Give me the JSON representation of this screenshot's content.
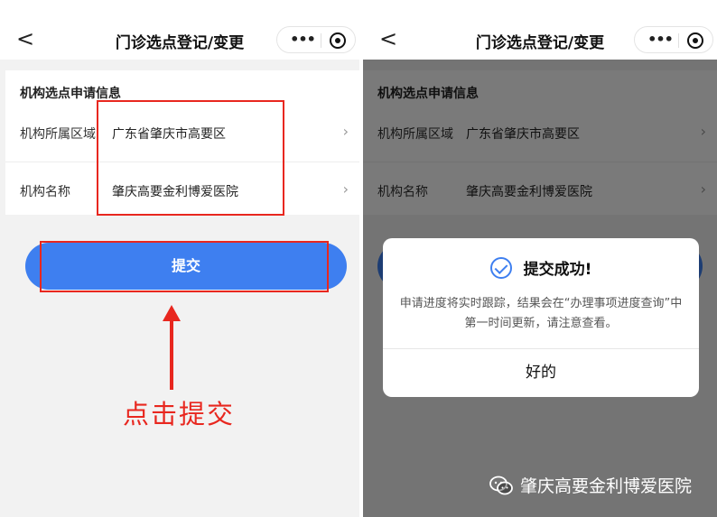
{
  "nav": {
    "back_glyph": "<",
    "title": "门诊选点登记/变更",
    "more_glyph": "•••",
    "status_dots": "••••"
  },
  "form": {
    "section_title": "机构选点申请信息",
    "fields": [
      {
        "label": "机构所属区域",
        "value": "广东省肇庆市高要区",
        "arrow": "›"
      },
      {
        "label": "机构名称",
        "value": "肇庆高要金利博爱医院",
        "arrow": "›"
      }
    ],
    "submit_label": "提交"
  },
  "annotation": {
    "hint": "点击提交",
    "color": "#e8271f"
  },
  "dialog": {
    "title": "提交成功!",
    "message": "申请进度将实时跟踪，结果会在“办理事项进度查询”中第一时间更新，请注意查看。",
    "ok_label": "好的"
  },
  "watermark": {
    "text": "肇庆高要金利博爱医院",
    "icon": "wechat-icon"
  },
  "colors": {
    "accent": "#3e7ff0",
    "annotation_red": "#e8271f"
  }
}
